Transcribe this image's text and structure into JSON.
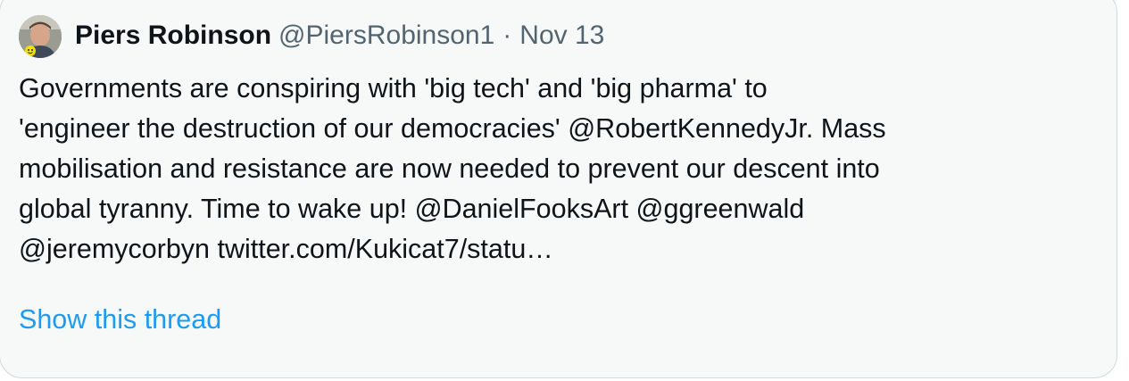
{
  "tweet": {
    "author": {
      "display_name": "Piers Robinson",
      "handle": "@PiersRobinson1"
    },
    "separator": "·",
    "date": "Nov 13",
    "text_lines": [
      "Governments are conspiring with 'big tech' and 'big pharma' to",
      "'engineer the destruction of our democracies' @RobertKennedyJr. Mass",
      "mobilisation and resistance are now needed to prevent our descent into",
      "global tyranny. Time to wake up! @DanielFooksArt @ggreenwald",
      "@jeremycorbyn twitter.com/Kukicat7/statu…"
    ],
    "show_thread_label": "Show this thread"
  },
  "colors": {
    "card_background": "#f7f9f9",
    "card_border": "#cfd9de",
    "primary_text": "#0f1419",
    "secondary_text": "#536471",
    "link": "#1d9bf0"
  }
}
